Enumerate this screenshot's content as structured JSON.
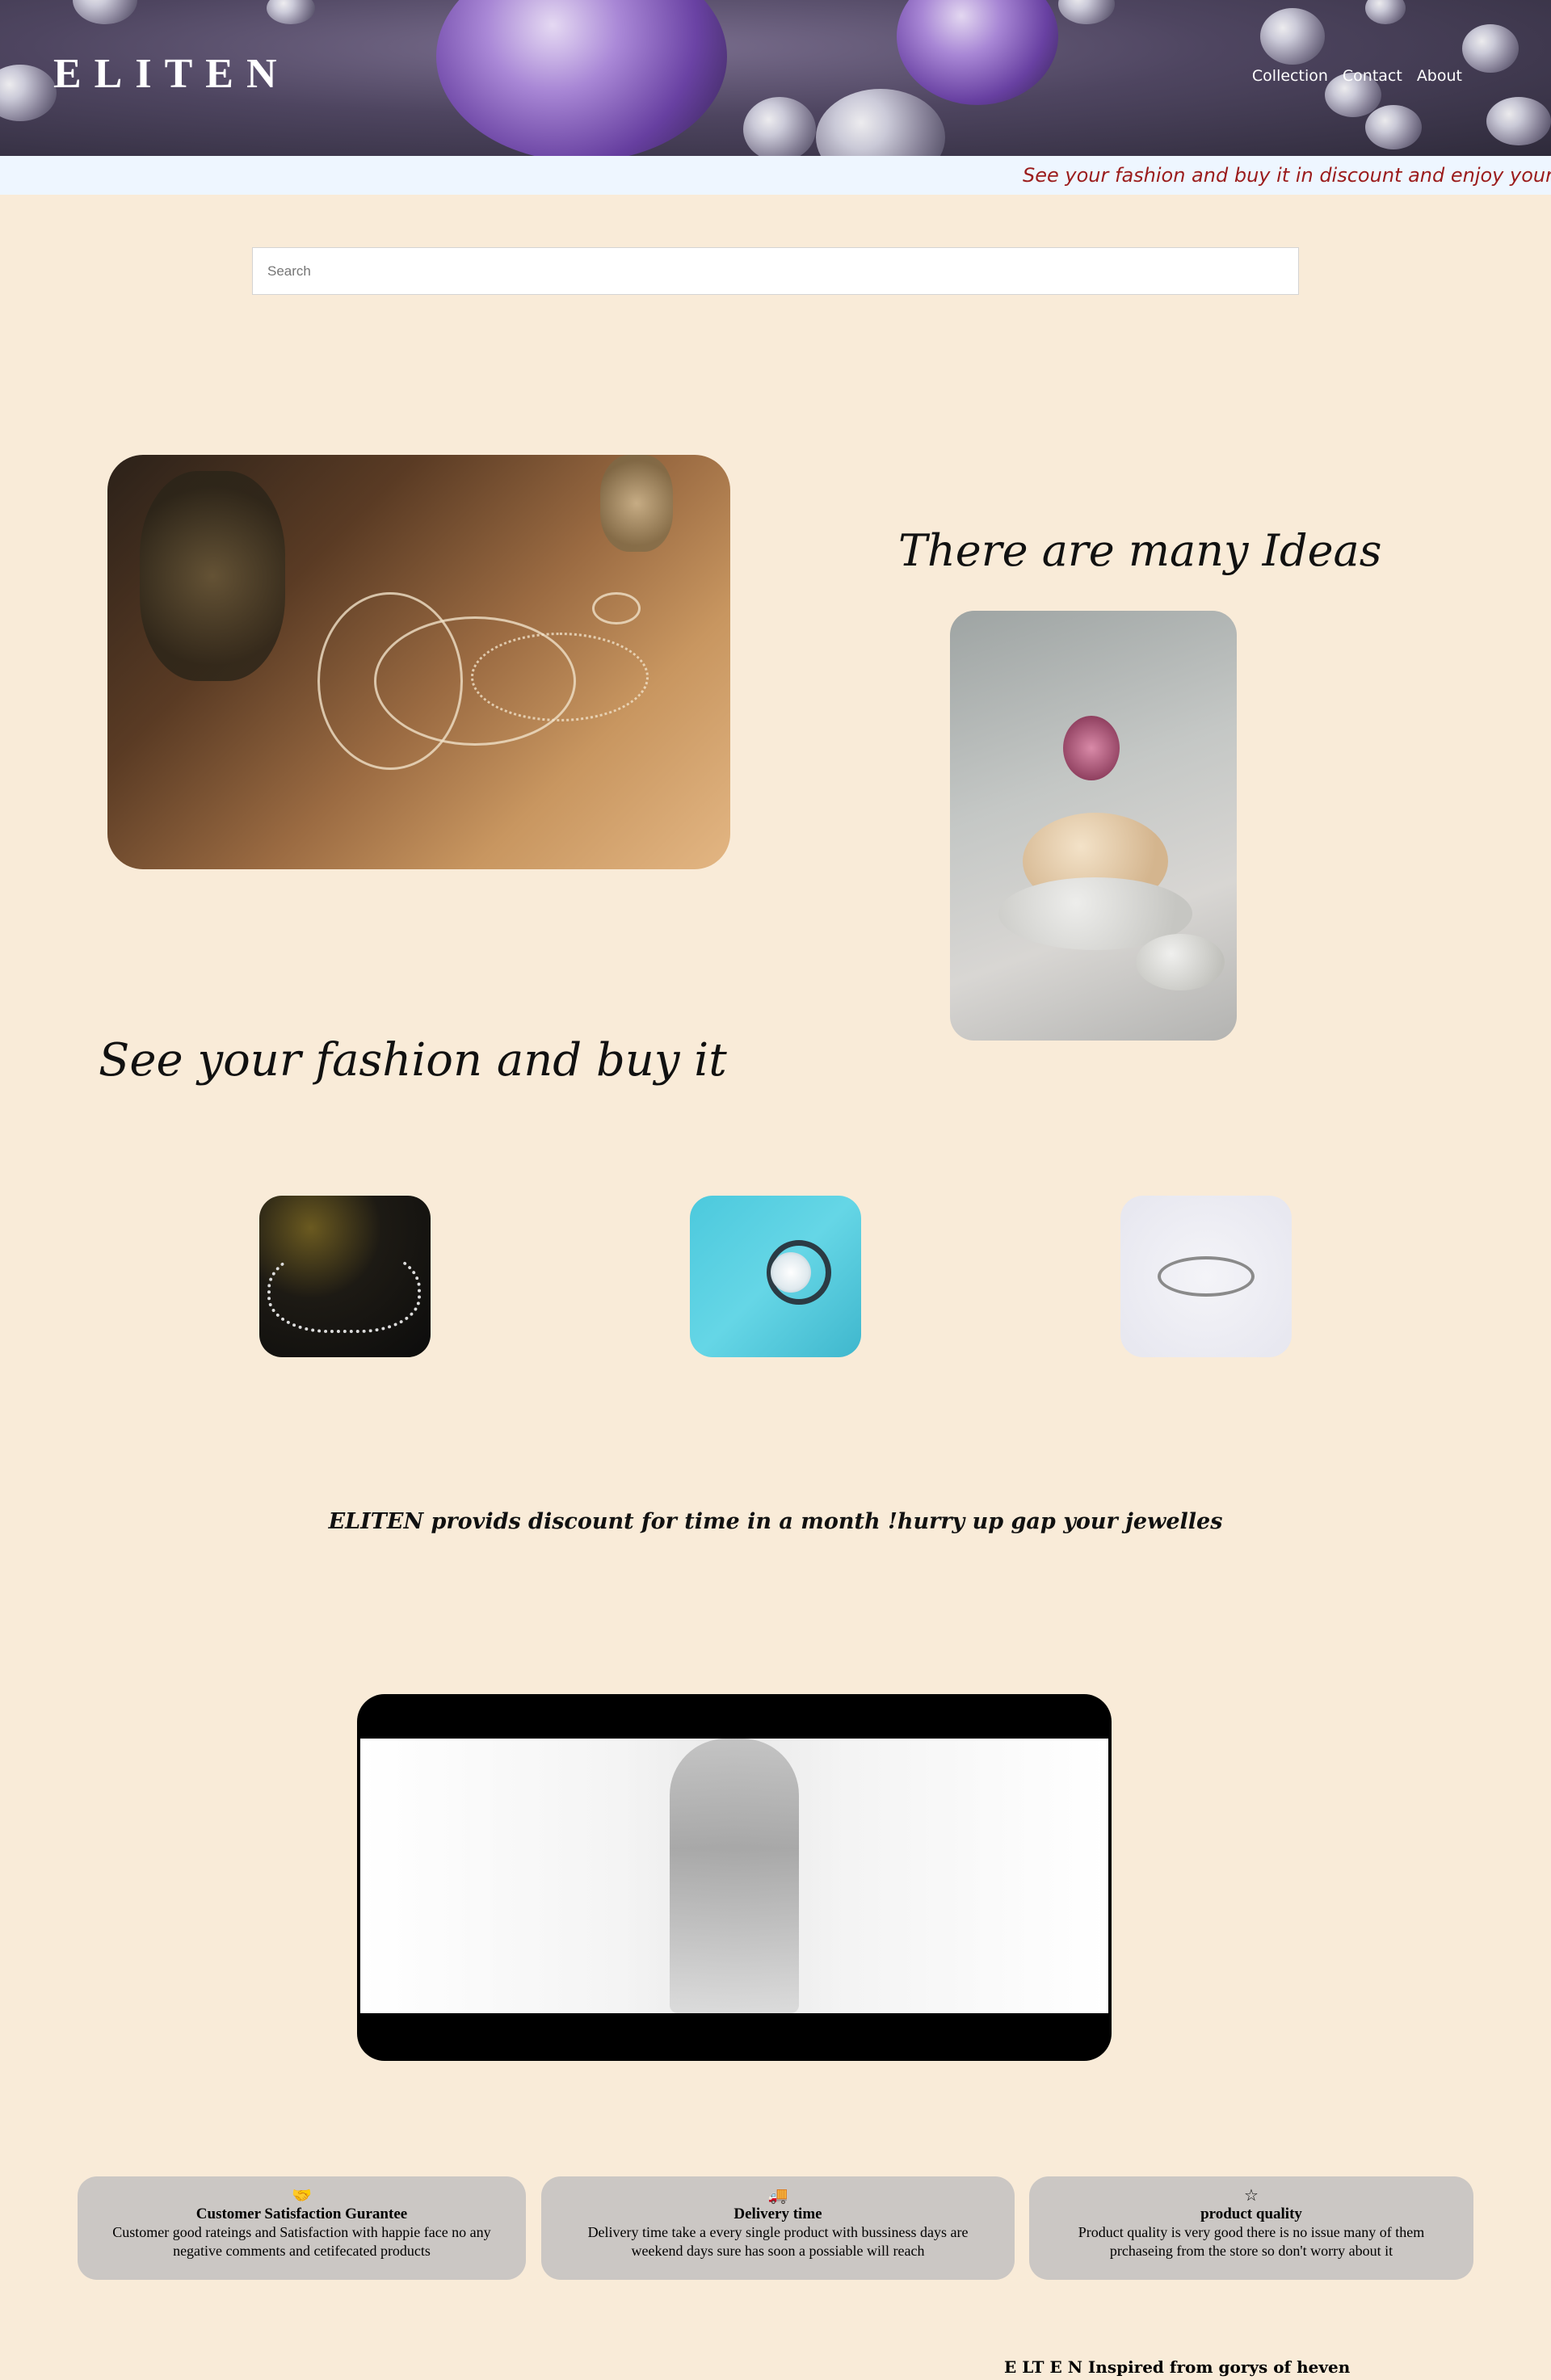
{
  "header": {
    "logo": "ELITEN",
    "nav": [
      "Collection",
      "Contact",
      "About"
    ]
  },
  "marquee": {
    "text": "See your fashion and buy it in discount and enjoy your fashion"
  },
  "search": {
    "placeholder": "Search"
  },
  "hero": {
    "ideas_heading": "There are many Ideas",
    "fashion_heading": "See your fashion and buy it"
  },
  "promo": {
    "text": "ELITEN provids discount for time in a month !hurry up gap your jewelles"
  },
  "features": [
    {
      "icon": "handshake-icon",
      "glyph": "🤝",
      "title": "Customer Satisfaction Gurantee",
      "text": "Customer good rateings and Satisfaction with happie face no any negative comments and cetifecated products"
    },
    {
      "icon": "truck-icon",
      "glyph": "🚚",
      "title": "Delivery time",
      "text": "Delivery time take a every single product with bussiness days are weekend days sure has soon a possiable will reach"
    },
    {
      "icon": "star-icon",
      "glyph": "☆",
      "title": "product quality",
      "text": "Product quality is very good there is no issue many of them prchaseing from the store so don't worry about it"
    }
  ],
  "footer": {
    "text": "E LT E N Inspired from gorys of heven"
  },
  "colors": {
    "background": "#f9ebd8",
    "marquee_bg": "#eef6ff",
    "marquee_text": "#9b1c1c",
    "card_bg": "#cbc7c4"
  }
}
